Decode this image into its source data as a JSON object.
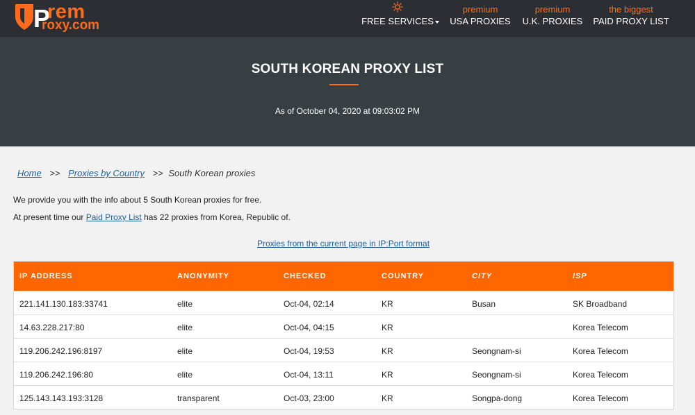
{
  "header": {
    "logo": {
      "brand_top": "rem",
      "brand_p": "P",
      "brand_bottom": "roxy.com"
    },
    "nav": [
      {
        "top": "",
        "label": "FREE SERVICES",
        "dropdown": true
      },
      {
        "top": "premium",
        "label": "USA PROXIES"
      },
      {
        "top": "premium",
        "label": "U.K. PROXIES"
      },
      {
        "top": "the biggest",
        "label": "PAID PROXY LIST"
      }
    ]
  },
  "hero": {
    "title": "SOUTH KOREAN PROXY LIST",
    "as_of": "As of October 04, 2020 at 09:03:02 PM"
  },
  "breadcrumb": {
    "home": "Home",
    "sep1": ">>",
    "by_country": "Proxies by Country",
    "sep2": ">>",
    "current": "South Korean proxies"
  },
  "intro": {
    "line1": "We provide you with the info about 5 South Korean proxies for free.",
    "line2_prefix": "At present time our ",
    "line2_link": "Paid Proxy List",
    "line2_suffix": " has 22 proxies from Korea, Republic of."
  },
  "format_link": "Proxies from the current page in IP:Port format",
  "table": {
    "headers": [
      "IP ADDRESS",
      "ANONYMITY",
      "CHECKED",
      "COUNTRY",
      "CITY",
      "ISP"
    ],
    "rows": [
      [
        "221.141.130.183:33741",
        "elite",
        "Oct-04, 02:14",
        "KR",
        "Busan",
        "SK Broadband"
      ],
      [
        "14.63.228.217:80",
        "elite",
        "Oct-04, 04:15",
        "KR",
        "",
        "Korea Telecom"
      ],
      [
        "119.206.242.196:8197",
        "elite",
        "Oct-04, 19:53",
        "KR",
        "Seongnam-si",
        "Korea Telecom"
      ],
      [
        "119.206.242.196:80",
        "elite",
        "Oct-04, 13:11",
        "KR",
        "Seongnam-si",
        "Korea Telecom"
      ],
      [
        "125.143.143.193:3128",
        "transparent",
        "Oct-03, 23:00",
        "KR",
        "Songpa-dong",
        "Korea Telecom"
      ]
    ]
  },
  "colors": {
    "accent": "#ff6600",
    "header_bg": "#2b2f33",
    "hero_bg": "#373f43",
    "link": "#1d5d9b"
  },
  "icons": {
    "logo": "shield-icon",
    "free_services": "sun-icon"
  }
}
